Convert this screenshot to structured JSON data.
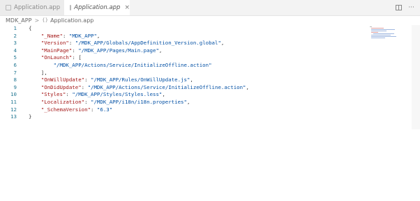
{
  "tabs": [
    {
      "label": "Application.app",
      "active": false
    },
    {
      "label": "Application.app",
      "active": true,
      "close": "×"
    }
  ],
  "breadcrumb": {
    "root": "MDK_APP",
    "separator": ">",
    "file": "Application.app",
    "file_icon": "{}"
  },
  "editor": {
    "lines": [
      {
        "n": "1",
        "text": "{"
      },
      {
        "n": "2",
        "text": "    \"_Name\": \"MDK_APP\","
      },
      {
        "n": "3",
        "text": "    \"Version\": \"/MDK_APP/Globals/AppDefinition_Version.global\","
      },
      {
        "n": "4",
        "text": "    \"MainPage\": \"/MDK_APP/Pages/Main.page\","
      },
      {
        "n": "5",
        "text": "    \"OnLaunch\": ["
      },
      {
        "n": "6",
        "text": "        \"/MDK_APP/Actions/Service/InitializeOffline.action\""
      },
      {
        "n": "7",
        "text": "    ],"
      },
      {
        "n": "8",
        "text": "    \"OnWillUpdate\": \"/MDK_APP/Rules/OnWillUpdate.js\","
      },
      {
        "n": "9",
        "text": "    \"OnDidUpdate\": \"/MDK_APP/Actions/Service/InitializeOffline.action\","
      },
      {
        "n": "10",
        "text": "    \"Styles\": \"/MDK_APP/Styles/Styles.less\","
      },
      {
        "n": "11",
        "text": "    \"Localization\": \"/MDK_APP/i18n/i18n.properties\","
      },
      {
        "n": "12",
        "text": "    \"_SchemaVersion\": \"6.3\""
      },
      {
        "n": "13",
        "text": "}"
      }
    ]
  },
  "colors": {
    "key": "#a31515",
    "string": "#0451a5",
    "line_number": "#237893"
  }
}
